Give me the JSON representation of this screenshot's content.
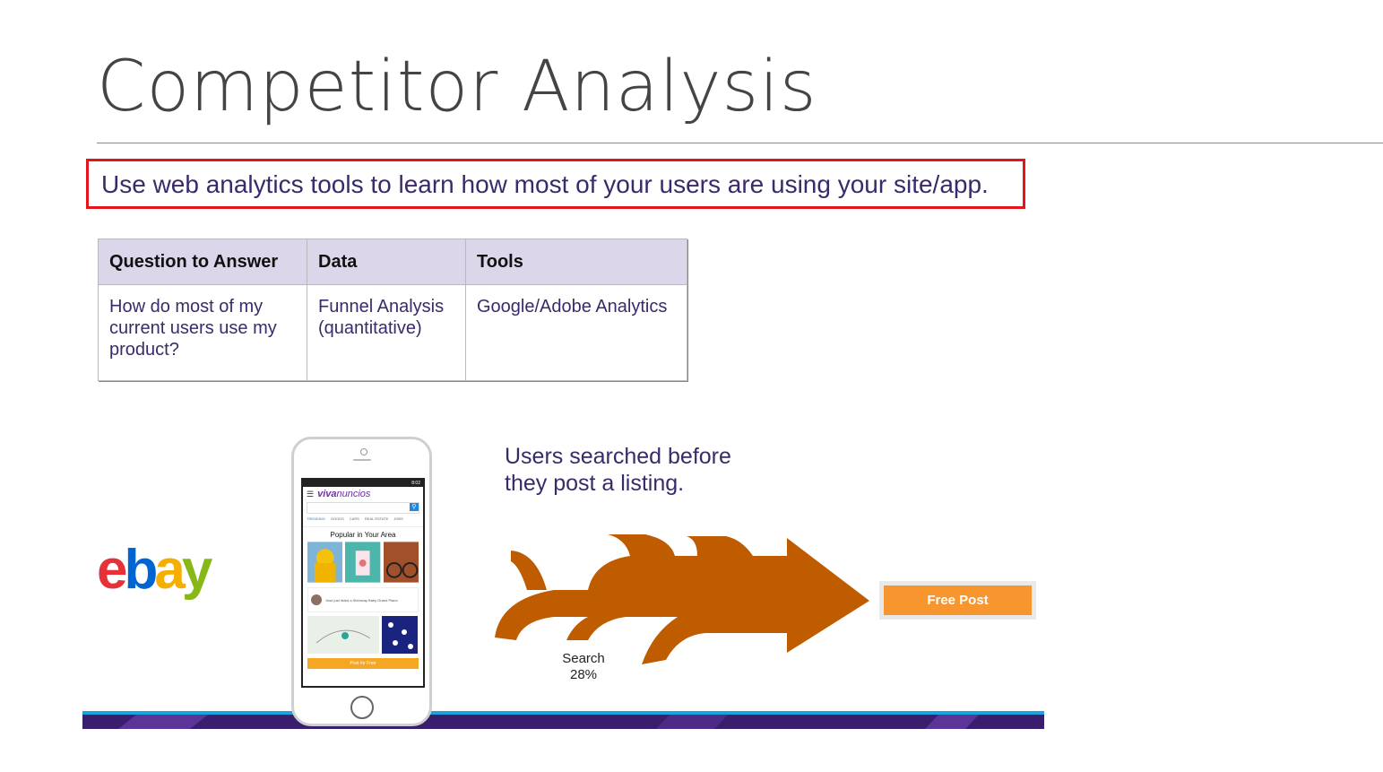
{
  "slide": {
    "title": "Competitor Analysis",
    "callout": "Use web analytics tools to learn how most of your users are using your site/app."
  },
  "table": {
    "headers": [
      "Question to Answer",
      "Data",
      "Tools"
    ],
    "row": {
      "question": "How do most of my current users use my product?",
      "data": "Funnel Analysis (quantitative)",
      "tools": "Google/Adobe Analytics"
    }
  },
  "logo": {
    "letters": [
      "e",
      "b",
      "a",
      "y"
    ],
    "colors": [
      "#e53238",
      "#0064d2",
      "#f5af02",
      "#86b817"
    ]
  },
  "phone_app": {
    "status_time": "8:02",
    "brand_prefix": "viva",
    "brand_suffix": "nuncios",
    "search_placeholder": "",
    "tabs": [
      "TRENDING",
      "GOODS",
      "CARS",
      "REAL ESTATE",
      "JOBS"
    ],
    "popular_heading": "Popular in Your Area",
    "listed_text": "Jose just listed a Steinway Baby Grand Piano",
    "post_button": "Post for Free"
  },
  "annotation": {
    "line1": "Users searched before",
    "line2": "they post a listing."
  },
  "funnel": {
    "step_label": "Search",
    "step_percent": "28%",
    "arrow_color": "#c05c00"
  },
  "free_post_button": "Free Post"
}
